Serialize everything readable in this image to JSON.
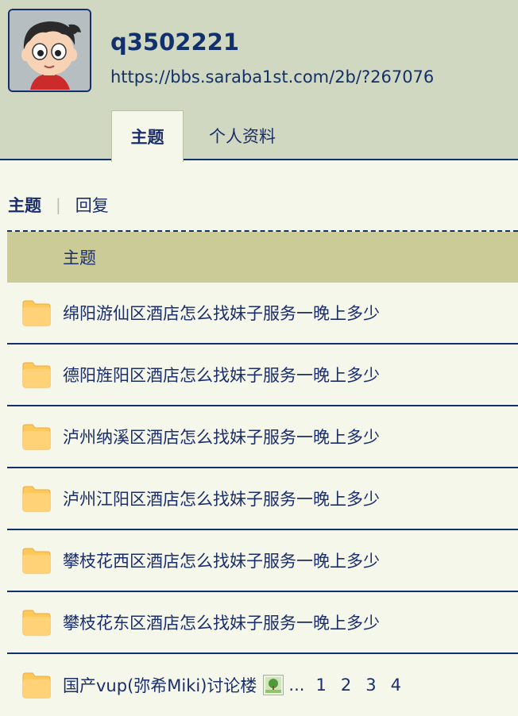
{
  "profile": {
    "username": "q3502221",
    "url": "https://bbs.saraba1st.com/2b/?267076",
    "avatar_icon": "cartoon-boy-avatar"
  },
  "tabs": [
    {
      "label": "主题",
      "active": true
    },
    {
      "label": "个人资料",
      "active": false
    }
  ],
  "subtabs": {
    "current": "主题",
    "separator": "|",
    "other": "回复"
  },
  "table": {
    "header": "主题",
    "rows": [
      {
        "title": "绵阳游仙区酒店怎么找妹子服务一晚上多少"
      },
      {
        "title": "德阳旌阳区酒店怎么找妹子服务一晚上多少"
      },
      {
        "title": "泸州纳溪区酒店怎么找妹子服务一晚上多少"
      },
      {
        "title": "泸州江阳区酒店怎么找妹子服务一晚上多少"
      },
      {
        "title": "攀枝花西区酒店怎么找妹子服务一晚上多少"
      },
      {
        "title": "攀枝花东区酒店怎么找妹子服务一晚上多少"
      },
      {
        "title": "国产vup(弥希Miki)讨论楼",
        "has_image_icon": true,
        "ellipsis": "...",
        "pages": [
          "1",
          "2",
          "3",
          "4"
        ]
      }
    ]
  },
  "colors": {
    "accent": "#12306b",
    "header_bg": "#d1d8c2",
    "page_bg": "#f5f7ea",
    "table_header_bg": "#cbcb98",
    "folder": "#ffc85a"
  }
}
